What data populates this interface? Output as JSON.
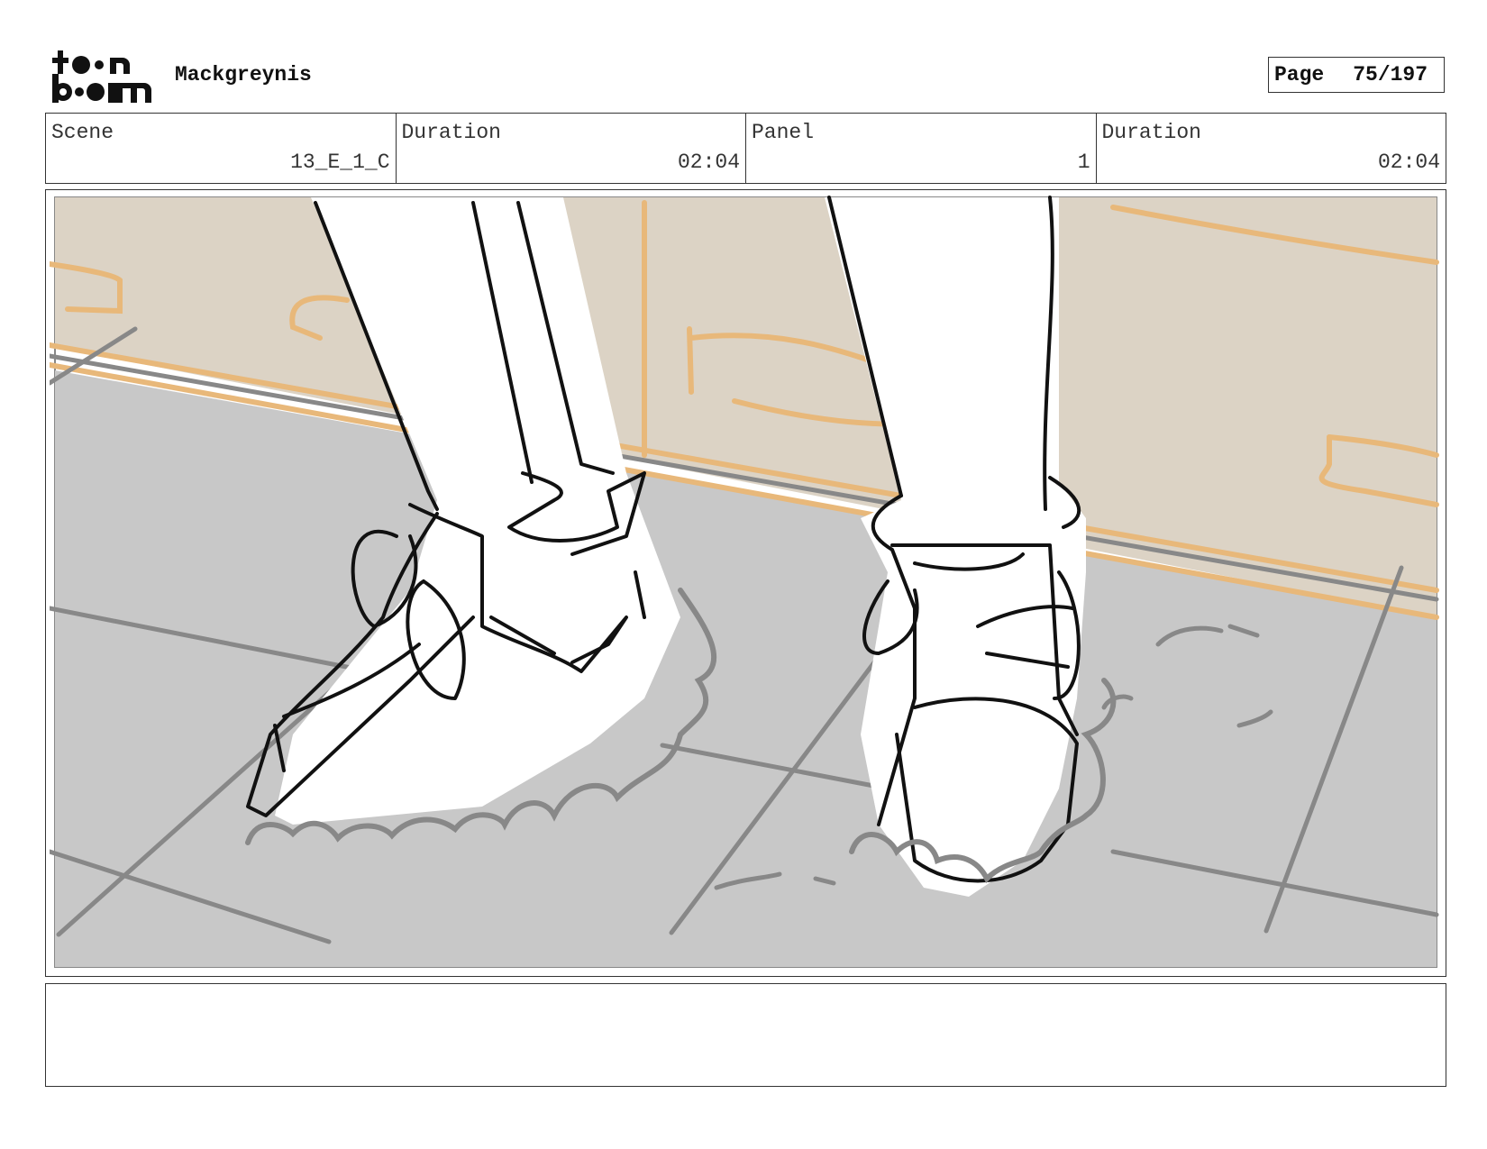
{
  "header": {
    "logo_top": "to●n",
    "logo_bottom": "b●●m",
    "project_name": "Mackgreynis",
    "page_label": "Page",
    "page_value": "75/197"
  },
  "info": {
    "scene_label": "Scene",
    "scene_value": "13_E_1_C",
    "duration1_label": "Duration",
    "duration1_value": "02:04",
    "panel_label": "Panel",
    "panel_value": "1",
    "duration2_label": "Duration",
    "duration2_value": "02:04"
  },
  "panel_image": {
    "description_icon": "storyboard-sketch",
    "wall_color": "#dcd3c5",
    "floor_color": "#c8c8c8",
    "baseboard_color": "#e8b87a"
  },
  "notes": {
    "text": ""
  }
}
